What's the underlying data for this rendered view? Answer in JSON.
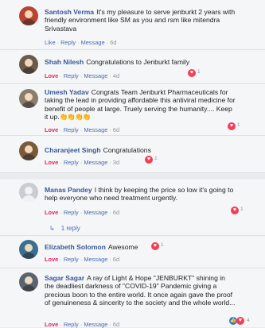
{
  "comments": [
    {
      "author": "Santosh Verma",
      "text": "It's my pleasure to serve jenburkt 2 years with friendly environment like SM as you and rsm like mitendra Srivastava",
      "actions": {
        "reaction": "Like",
        "reply": "Reply",
        "message": "Message",
        "time": "6d"
      }
    },
    {
      "author": "Shah Nilesh",
      "text": "Congratulations to Jenburkt family",
      "actions": {
        "reaction": "Love",
        "reply": "Reply",
        "message": "Message",
        "time": "4d"
      },
      "react_count": "1"
    },
    {
      "author": "Umesh Yadav",
      "text": "Congrats Team Jenburkt Pharmaceuticals for taking the lead in providing affordable this antiviral medicine for benefit of people at large. Truely serving the humanity.... Keep it up.",
      "emojis": "👏👏👏👏",
      "actions": {
        "reaction": "Love",
        "reply": "Reply",
        "message": "Message",
        "time": "6d"
      },
      "react_count": "1"
    },
    {
      "author": "Charanjeet Singh",
      "text": "Congratulations",
      "actions": {
        "reaction": "Love",
        "reply": "Reply",
        "message": "Message",
        "time": "3d"
      },
      "react_count": "1"
    },
    {
      "author": "Manas Pandey",
      "text": "I think by keeping the price so low it's going to help everyone who need treatment urgently.",
      "actions": {
        "reaction": "Love",
        "reply": "Reply",
        "message": "Message",
        "time": "6d"
      },
      "react_count": "1",
      "replies": "1 reply"
    },
    {
      "author": "Elizabeth Solomon",
      "text": "Awesome",
      "actions": {
        "reaction": "Love",
        "reply": "Reply",
        "message": "Message",
        "time": "6d"
      },
      "react_count": "1"
    },
    {
      "author": "Sagar Sagar",
      "text": "A ray of Light & Hope \"JENBURKT\" shining in the deadliest darkness of \"COVID-19\" Pandemic giving a precious boon to the entire world. It once again gave the proof of genuineness & sincerity to the society and the whole world...",
      "actions": {
        "reaction": "Love",
        "reply": "Reply",
        "message": "Message",
        "time": "6d"
      },
      "react_count": "4"
    }
  ],
  "colors": {
    "author": "#385898",
    "love": "#e0245e",
    "heart_badge": "#f33e58",
    "like_badge": "#1877f2"
  },
  "icons": [
    "heart-icon",
    "like-icon",
    "reply-arrow-icon",
    "avatar"
  ]
}
